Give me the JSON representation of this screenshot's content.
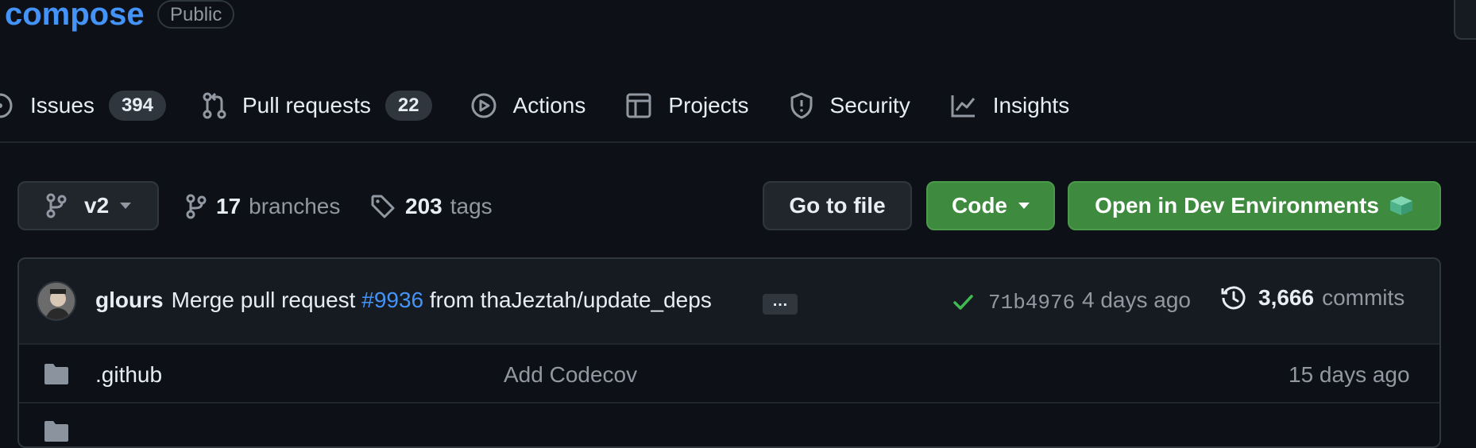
{
  "repo": {
    "name": "compose",
    "visibility": "Public"
  },
  "nav": {
    "items": [
      {
        "label": "Issues",
        "count": "394"
      },
      {
        "label": "Pull requests",
        "count": "22"
      },
      {
        "label": "Actions"
      },
      {
        "label": "Projects"
      },
      {
        "label": "Security"
      },
      {
        "label": "Insights"
      }
    ]
  },
  "toolbar": {
    "branch": "v2",
    "branches_count": "17",
    "branches_label": "branches",
    "tags_count": "203",
    "tags_label": "tags",
    "go_to_file": "Go to file",
    "code": "Code",
    "dev_env": "Open in Dev Environments"
  },
  "latest_commit": {
    "author": "glours",
    "message_prefix": "Merge pull request",
    "pr": "#9936",
    "message_suffix": "from thaJeztah/update_deps",
    "ellipsis": "…",
    "sha": "71b4976",
    "age": "4 days ago",
    "commits_count": "3,666",
    "commits_label": "commits"
  },
  "files": [
    {
      "name": ".github",
      "message": "Add Codecov",
      "age": "15 days ago"
    }
  ],
  "colors": {
    "accent": "#4493f8",
    "success": "#3fb950",
    "button_green": "#3e8a3f"
  }
}
